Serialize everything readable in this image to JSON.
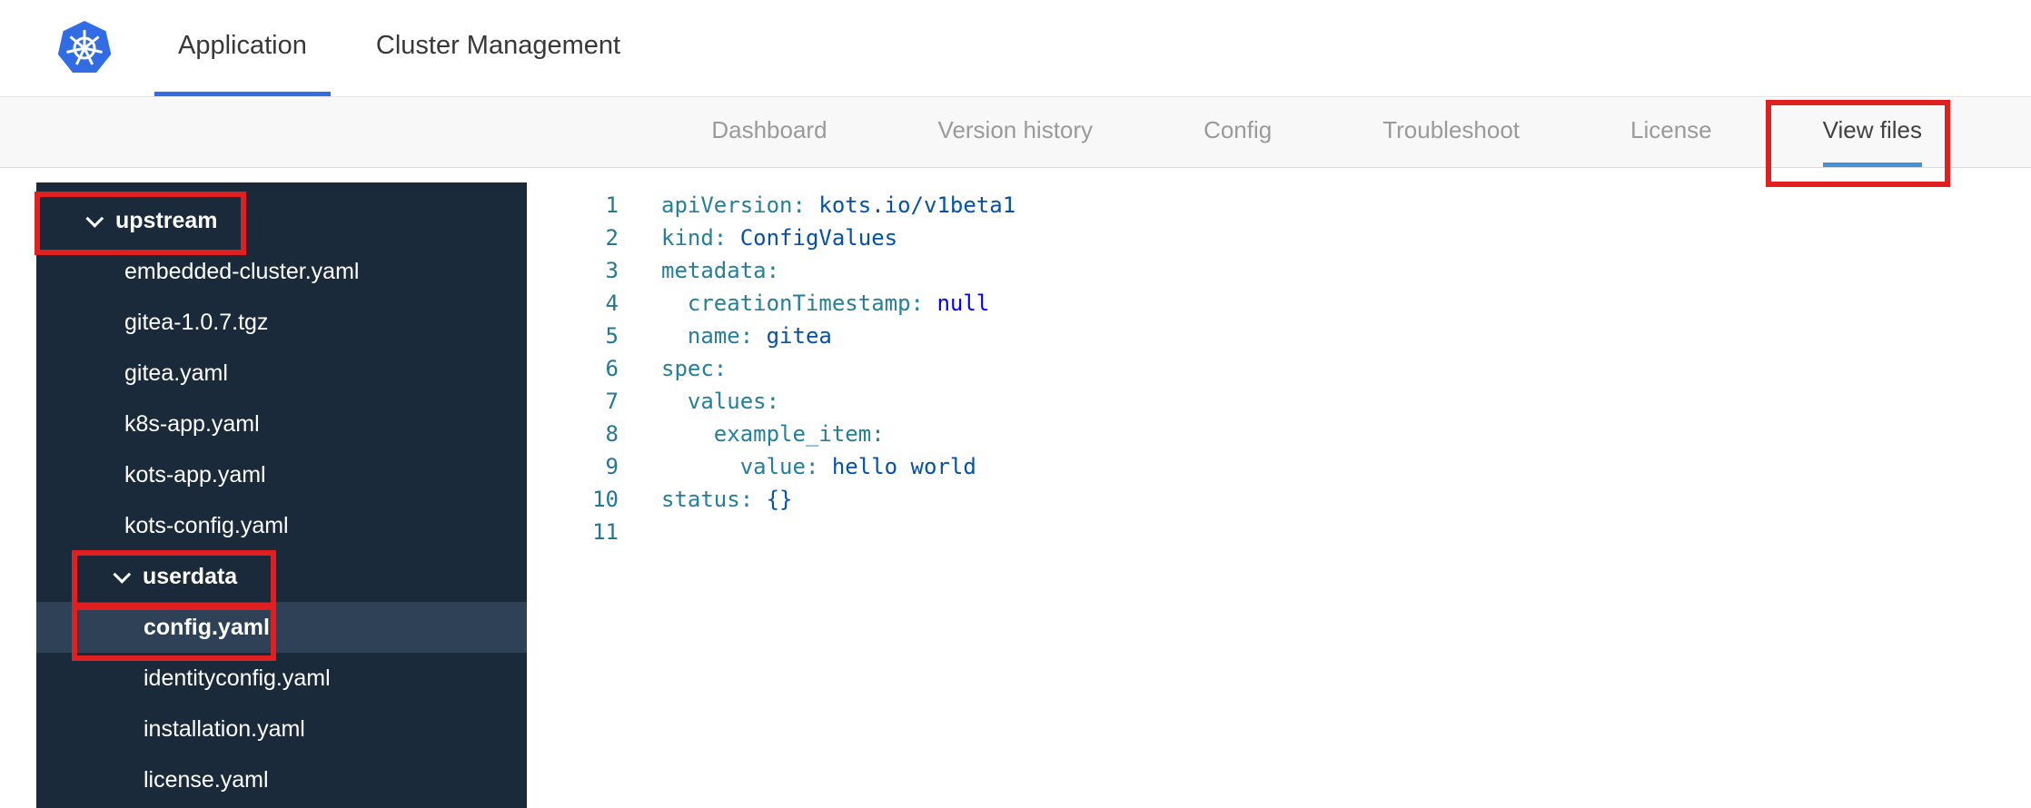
{
  "header": {
    "logo": "kubernetes",
    "tabs": [
      {
        "label": "Application",
        "active": true
      },
      {
        "label": "Cluster Management",
        "active": false
      }
    ]
  },
  "subnav": {
    "items": [
      {
        "label": "Dashboard",
        "active": false
      },
      {
        "label": "Version history",
        "active": false
      },
      {
        "label": "Config",
        "active": false
      },
      {
        "label": "Troubleshoot",
        "active": false
      },
      {
        "label": "License",
        "active": false
      },
      {
        "label": "View files",
        "active": true
      }
    ]
  },
  "sidebar": {
    "tree": [
      {
        "type": "folder",
        "label": "upstream",
        "level": 0,
        "expanded": true
      },
      {
        "type": "file",
        "label": "embedded-cluster.yaml",
        "level": 1
      },
      {
        "type": "file",
        "label": "gitea-1.0.7.tgz",
        "level": 1
      },
      {
        "type": "file",
        "label": "gitea.yaml",
        "level": 1
      },
      {
        "type": "file",
        "label": "k8s-app.yaml",
        "level": 1
      },
      {
        "type": "file",
        "label": "kots-app.yaml",
        "level": 1
      },
      {
        "type": "file",
        "label": "kots-config.yaml",
        "level": 1
      },
      {
        "type": "folder",
        "label": "userdata",
        "level": 1,
        "expanded": true
      },
      {
        "type": "file",
        "label": "config.yaml",
        "level": 2,
        "selected": true
      },
      {
        "type": "file",
        "label": "identityconfig.yaml",
        "level": 2
      },
      {
        "type": "file",
        "label": "installation.yaml",
        "level": 2
      },
      {
        "type": "file",
        "label": "license.yaml",
        "level": 2
      }
    ]
  },
  "editor": {
    "lines": [
      {
        "num": "1",
        "tokens": [
          [
            "key",
            "apiVersion:"
          ],
          [
            "plain",
            " "
          ],
          [
            "value",
            "kots.io/v1beta1"
          ]
        ]
      },
      {
        "num": "2",
        "tokens": [
          [
            "key",
            "kind:"
          ],
          [
            "plain",
            " "
          ],
          [
            "value",
            "ConfigValues"
          ]
        ]
      },
      {
        "num": "3",
        "tokens": [
          [
            "key",
            "metadata:"
          ]
        ]
      },
      {
        "num": "4",
        "tokens": [
          [
            "plain",
            "  "
          ],
          [
            "key",
            "creationTimestamp:"
          ],
          [
            "plain",
            " "
          ],
          [
            "kw",
            "null"
          ]
        ]
      },
      {
        "num": "5",
        "tokens": [
          [
            "plain",
            "  "
          ],
          [
            "key",
            "name:"
          ],
          [
            "plain",
            " "
          ],
          [
            "value",
            "gitea"
          ]
        ]
      },
      {
        "num": "6",
        "tokens": [
          [
            "key",
            "spec:"
          ]
        ]
      },
      {
        "num": "7",
        "tokens": [
          [
            "plain",
            "  "
          ],
          [
            "key",
            "values:"
          ]
        ]
      },
      {
        "num": "8",
        "tokens": [
          [
            "plain",
            "    "
          ],
          [
            "key",
            "example_item:"
          ]
        ]
      },
      {
        "num": "9",
        "tokens": [
          [
            "plain",
            "      "
          ],
          [
            "key",
            "value:"
          ],
          [
            "plain",
            " "
          ],
          [
            "value",
            "hello world"
          ]
        ]
      },
      {
        "num": "10",
        "tokens": [
          [
            "key",
            "status:"
          ],
          [
            "plain",
            " "
          ],
          [
            "value",
            "{}"
          ]
        ]
      },
      {
        "num": "11",
        "tokens": []
      }
    ]
  },
  "annotations": {
    "highlight_color": "#e02020",
    "highlighted_regions": [
      "View files tab",
      "upstream folder",
      "userdata folder",
      "config.yaml file"
    ]
  },
  "colors": {
    "kubernetes_blue": "#326ce5",
    "header_active_underline": "#326de6",
    "subnav_active_underline": "#4591d8",
    "sidebar_bg": "#1b2a3a",
    "sidebar_selected_bg": "#2e4157",
    "annotation_red": "#e02020",
    "code_key": "#267f99",
    "code_value": "#0451a5",
    "code_keyword": "#0000ff",
    "line_number": "#237893"
  }
}
